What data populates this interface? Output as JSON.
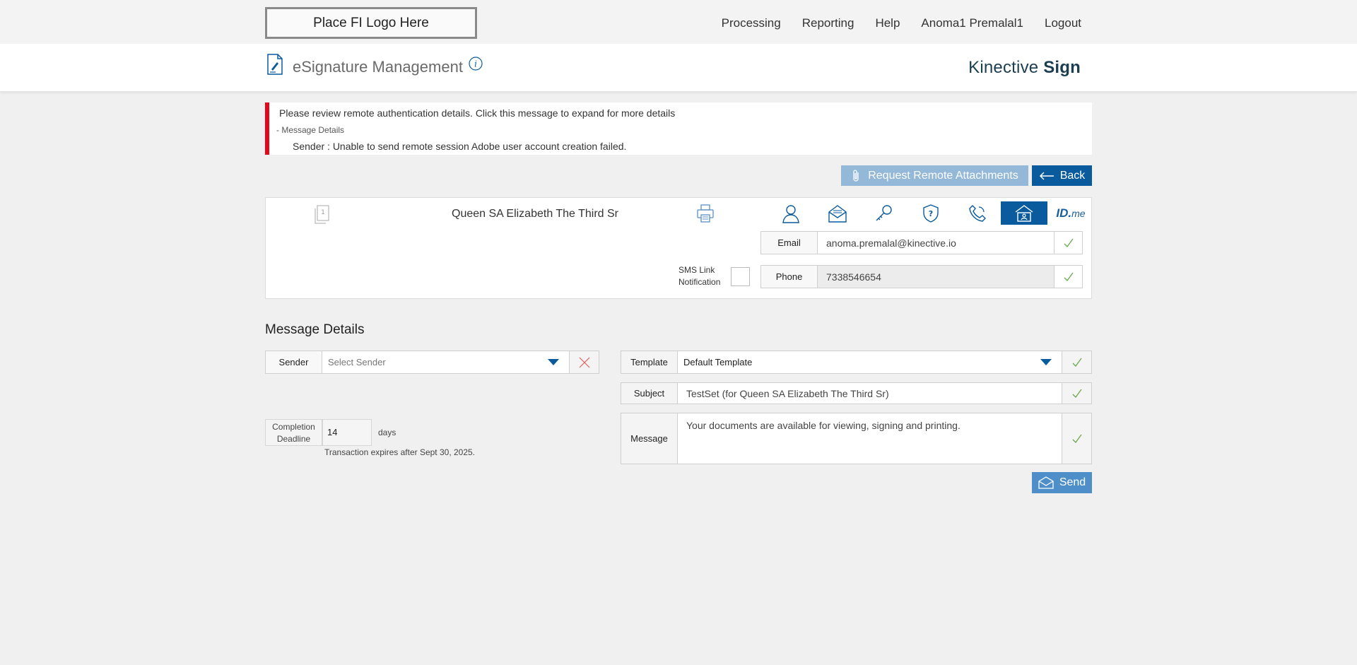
{
  "topbar": {
    "logo_text": "Place FI Logo Here",
    "nav": [
      "Processing",
      "Reporting",
      "Help",
      "Anoma1 Premalal1",
      "Logout"
    ]
  },
  "header": {
    "title": "eSignature Management",
    "brand_light": "Kinective ",
    "brand_bold": "Sign"
  },
  "alert": {
    "title": "Please review remote authentication details. Click this message to expand for more details",
    "toggle": "- Message Details",
    "detail": "Sender :  Unable to send remote session Adobe user account creation failed."
  },
  "actions": {
    "attach_label": "Request Remote Attachments",
    "back_label": "Back"
  },
  "signer": {
    "page_number": "1",
    "name": "Queen SA Elizabeth The Third Sr",
    "idme_bold": "ID.",
    "idme_light": "me",
    "email_label": "Email",
    "email_value": "anoma.premalal@kinective.io",
    "phone_label": "Phone",
    "phone_value": "7338546654",
    "sms_label_1": "SMS Link",
    "sms_label_2": "Notification"
  },
  "message": {
    "section_title": "Message Details",
    "sender_label": "Sender",
    "sender_placeholder": "Select Sender",
    "deadline_label_1": "Completion",
    "deadline_label_2": "Deadline",
    "deadline_value": "14",
    "days_label": "days",
    "expires_text": "Transaction expires after Sept 30, 2025.",
    "template_label": "Template",
    "template_value": "Default Template",
    "subject_label": "Subject",
    "subject_value": "TestSet (for Queen SA Elizabeth The Third Sr)",
    "message_label": "Message",
    "message_value": "Your documents are available for viewing, signing and printing.",
    "send_label": "Send"
  },
  "colors": {
    "primary": "#0a5a9e",
    "alert_red": "#e5081a",
    "check_green": "#6aa84f",
    "disabled_blue": "#94b8d8"
  }
}
